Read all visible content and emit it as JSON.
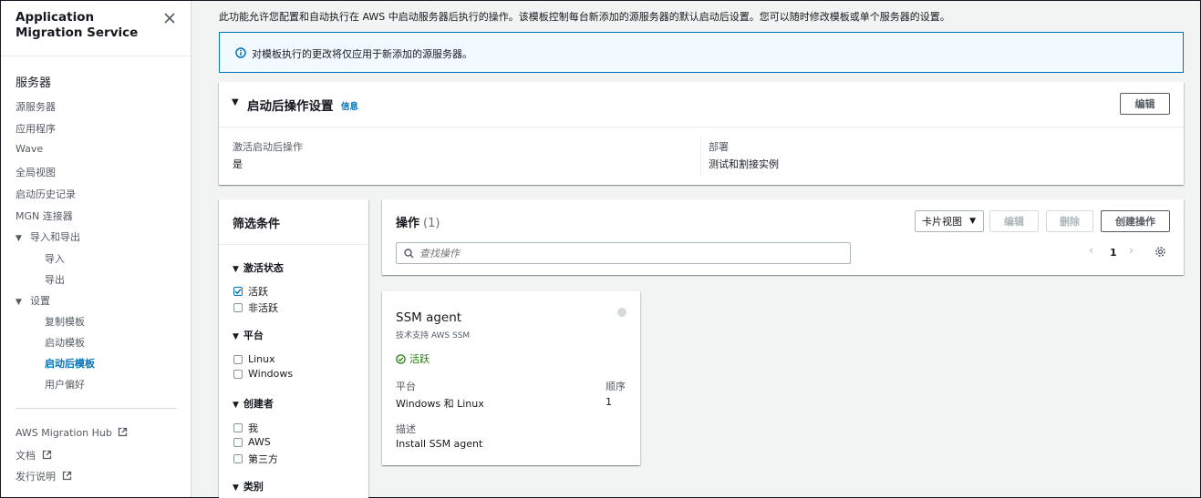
{
  "sidebar": {
    "title": "Application Migration Service",
    "section_title": "服务器",
    "items": [
      {
        "label": "源服务器"
      },
      {
        "label": "应用程序"
      },
      {
        "label": "Wave"
      },
      {
        "label": "全局视图"
      },
      {
        "label": "启动历史记录"
      },
      {
        "label": "MGN 连接器"
      },
      {
        "label": "导入和导出"
      },
      {
        "label": "导入"
      },
      {
        "label": "导出"
      },
      {
        "label": "设置"
      },
      {
        "label": "复制模板"
      },
      {
        "label": "启动模板"
      },
      {
        "label": "启动后模板"
      },
      {
        "label": "用户偏好"
      }
    ],
    "external": [
      {
        "label": "AWS Migration Hub"
      },
      {
        "label": "文档"
      },
      {
        "label": "发行说明"
      }
    ]
  },
  "main": {
    "intro": "此功能允许您配置和自动执行在 AWS 中启动服务器后执行的操作。该模板控制每台新添加的源服务器的默认启动后设置。您可以随时修改模板或单个服务器的设置。",
    "alert": "对模板执行的更改将仅应用于新添加的源服务器。",
    "post_launch": {
      "title": "启动后操作设置",
      "info": "信息",
      "edit": "编辑",
      "activate_label": "激活启动后操作",
      "activate_value": "是",
      "deploy_label": "部署",
      "deploy_value": "测试和割接实例"
    },
    "filters": {
      "title": "筛选条件",
      "groups": [
        {
          "title": "激活状态",
          "options": [
            {
              "label": "活跃",
              "checked": true
            },
            {
              "label": "非活跃",
              "checked": false
            }
          ]
        },
        {
          "title": "平台",
          "options": [
            {
              "label": "Linux",
              "checked": false
            },
            {
              "label": "Windows",
              "checked": false
            }
          ]
        },
        {
          "title": "创建者",
          "options": [
            {
              "label": "我",
              "checked": false
            },
            {
              "label": "AWS",
              "checked": false
            },
            {
              "label": "第三方",
              "checked": false
            }
          ]
        },
        {
          "title": "类别",
          "options": []
        }
      ]
    },
    "actions": {
      "title": "操作",
      "count": "(1)",
      "view_select": "卡片视图",
      "edit": "编辑",
      "delete": "删除",
      "create": "创建操作",
      "search_placeholder": "查找操作",
      "page": "1"
    },
    "card": {
      "title": "SSM agent",
      "subtitle": "技术支持 AWS SSM",
      "status": "活跃",
      "platform_label": "平台",
      "platform_value": "Windows 和 Linux",
      "order_label": "顺序",
      "order_value": "1",
      "desc_label": "描述",
      "desc_value": "Install SSM agent"
    }
  },
  "colors": {
    "link": "#0073bb",
    "success": "#1d8102",
    "border": "#d5dbdb",
    "text": "#16191f",
    "muted": "#545b64"
  }
}
